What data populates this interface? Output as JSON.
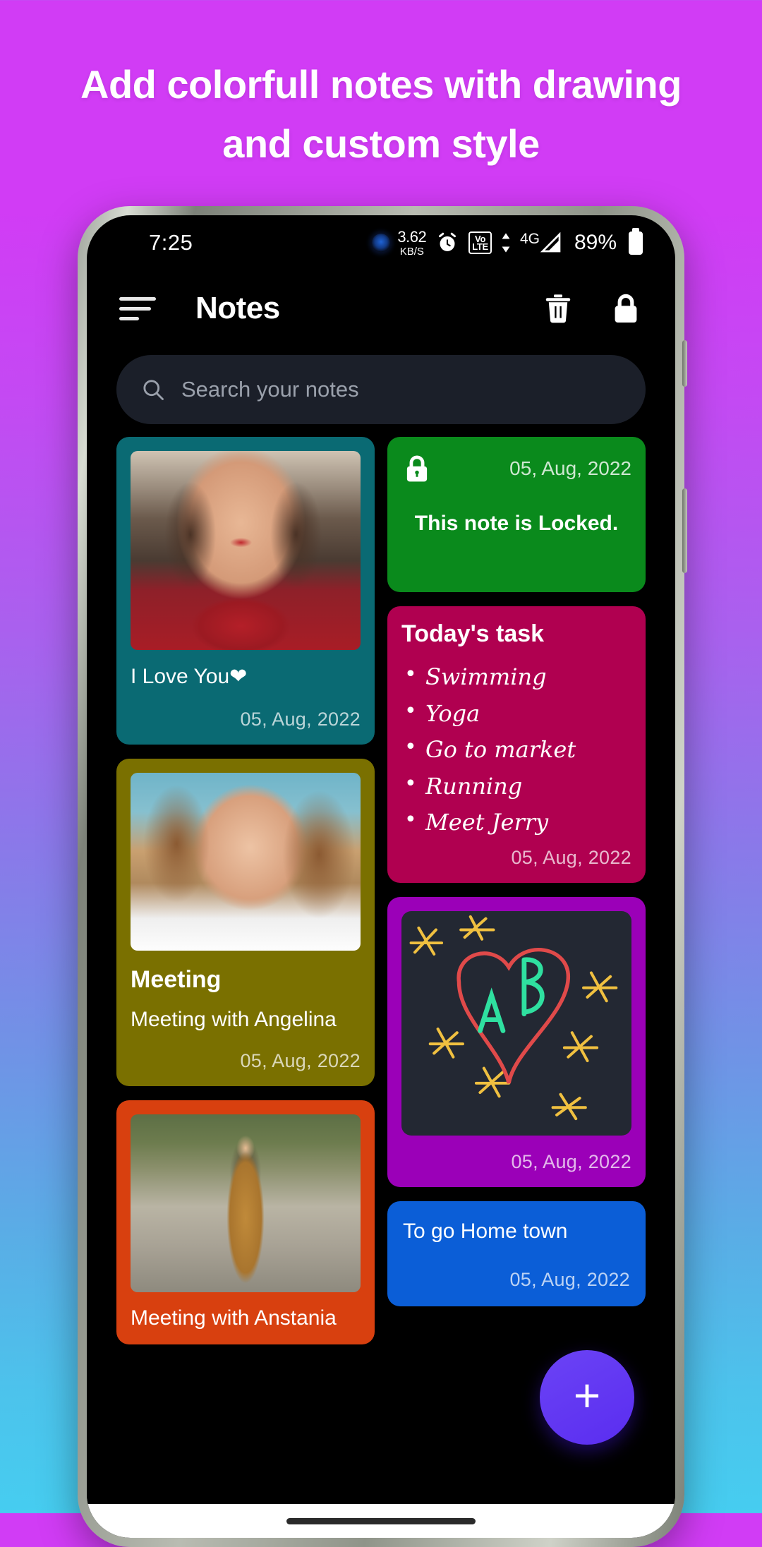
{
  "promo": {
    "headline_line1": "Add colorfull notes with drawing",
    "headline_line2": "and custom style",
    "background_top_color": "#d13cf5",
    "background_bottom_color": "#46cdf0"
  },
  "statusbar": {
    "time": "7:25",
    "network_speed_value": "3.62",
    "network_speed_unit": "KB/S",
    "alarm_icon": "alarm-clock-icon",
    "volte_label_top": "Vo",
    "volte_label_bottom": "LTE",
    "network_type": "4G",
    "battery_percent": "89%"
  },
  "appbar": {
    "menu_icon": "hamburger-menu-icon",
    "title": "Notes",
    "delete_icon": "trash-icon",
    "lock_icon": "padlock-icon"
  },
  "search": {
    "icon": "search-icon",
    "placeholder": "Search your notes",
    "value": ""
  },
  "notes": {
    "left_column": [
      {
        "id": "note-i-love-you",
        "bg": "#0a6a73",
        "thumb": "photo-smiling-woman-red-sweater",
        "title": "I Love You❤",
        "date": "05, Aug, 2022"
      },
      {
        "id": "note-meeting",
        "bg": "#7a7000",
        "thumb": "photo-woman-looking-up",
        "title": "Meeting",
        "body": "Meeting with Angelina",
        "date": "05, Aug, 2022"
      },
      {
        "id": "note-meeting-anstania",
        "bg": "#d8400f",
        "thumb": "photo-woman-on-road",
        "title": "Meeting with Anstania",
        "date": ""
      }
    ],
    "right_column": [
      {
        "id": "note-locked",
        "bg": "#0a8a1c",
        "lock_icon": "padlock-icon",
        "date": "05, Aug, 2022",
        "message": "This note is Locked."
      },
      {
        "id": "note-todays-task",
        "bg": "#b00050",
        "title": "Today's task",
        "tasks": [
          "Swimming",
          "Yoga",
          "Go to market",
          "Running",
          "Meet Jerry"
        ],
        "date": "05, Aug, 2022"
      },
      {
        "id": "note-drawing",
        "bg": "#9b00b8",
        "drawing": "heart-with-letters-a-b-and-stars",
        "canvas_bg": "#232833",
        "heart_color": "#e04a4a",
        "letters_color": "#2fe0a0",
        "stars_color": "#f0c040",
        "letter_a": "A",
        "letter_b": "B",
        "date": "05, Aug, 2022"
      },
      {
        "id": "note-home-town",
        "bg": "#0b5ed7",
        "title": "To go Home town",
        "date": "05, Aug, 2022"
      }
    ]
  },
  "fab": {
    "icon": "plus-icon",
    "label": "+",
    "color": "#5a2df0"
  },
  "navbar": {
    "gesture_pill": "home-gesture-pill"
  }
}
